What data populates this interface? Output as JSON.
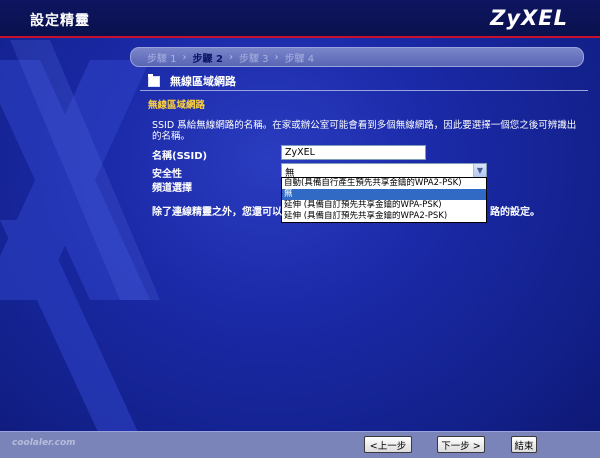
{
  "header": {
    "app_title": "設定精靈",
    "brand": "ZyXEL"
  },
  "steps": [
    {
      "label": "步驟 1",
      "active": false
    },
    {
      "label": "步驟 2",
      "active": true
    },
    {
      "label": "步驟 3",
      "active": false
    },
    {
      "label": "步驟 4",
      "active": false
    }
  ],
  "steps_separator": "›",
  "section": {
    "title": "無線區域網路",
    "subtitle": "無線區域網路",
    "description": "SSID 爲給無線網路的名稱。在家或辦公室可能會看到多個無線網路，因此要選擇一個您之後可辨識出的名稱。"
  },
  "form": {
    "ssid_label": "名稱(SSID)",
    "ssid_value": "ZyXEL",
    "security_label": "安全性",
    "security_value": "無",
    "channel_label": "頻道選擇",
    "security_options": [
      "自動(具備自行產生預先共享金鑰的WPA2-PSK)",
      "無",
      "延伸 (具備自訂預先共享金鑰的WPA-PSK)",
      "延伸 (具備自訂預先共享金鑰的WPA2-PSK)"
    ],
    "selected_option_index": 1
  },
  "note_start": "除了連線精靈之外，您還可以",
  "note_end": "路的設定。",
  "buttons": {
    "back": "<上一步",
    "next": "下一步 >",
    "finish": "結束"
  },
  "watermark": "coolaler.com",
  "colors": {
    "background": "#1b2aa8",
    "accent_red": "#c8102e",
    "subhead_yellow": "#ffd23a",
    "selection": "#316ac5"
  }
}
